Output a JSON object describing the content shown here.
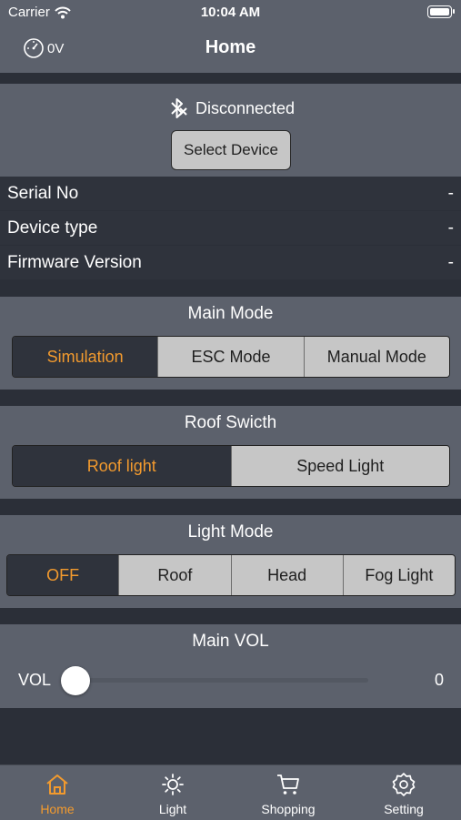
{
  "status_bar": {
    "carrier": "Carrier",
    "time": "10:04 AM"
  },
  "nav": {
    "title": "Home",
    "voltage": "0V"
  },
  "connection": {
    "status": "Disconnected",
    "select_device_label": "Select Device"
  },
  "device_info": [
    {
      "label": "Serial No",
      "value": "-"
    },
    {
      "label": "Device type",
      "value": "-"
    },
    {
      "label": "Firmware Version",
      "value": "-"
    }
  ],
  "main_mode": {
    "title": "Main Mode",
    "options": [
      "Simulation",
      "ESC Mode",
      "Manual Mode"
    ],
    "selected": "Simulation"
  },
  "roof_switch": {
    "title": "Roof Swicth",
    "options": [
      "Roof light",
      "Speed Light"
    ],
    "selected": "Roof light"
  },
  "light_mode": {
    "title": "Light Mode",
    "options": [
      "OFF",
      "Roof",
      "Head",
      "Fog Light"
    ],
    "selected": "OFF"
  },
  "main_vol": {
    "title": "Main VOL",
    "label": "VOL",
    "value": "0",
    "level": 0
  },
  "tabs": [
    {
      "label": "Home",
      "icon": "home-icon",
      "active": true
    },
    {
      "label": "Light",
      "icon": "sun-icon",
      "active": false
    },
    {
      "label": "Shopping",
      "icon": "cart-icon",
      "active": false
    },
    {
      "label": "Setting",
      "icon": "gear-icon",
      "active": false
    }
  ],
  "colors": {
    "accent": "#f29a2e",
    "panel": "#5c616c",
    "background": "#2b2f38",
    "row": "#2f333c",
    "segment": "#c6c6c6"
  }
}
